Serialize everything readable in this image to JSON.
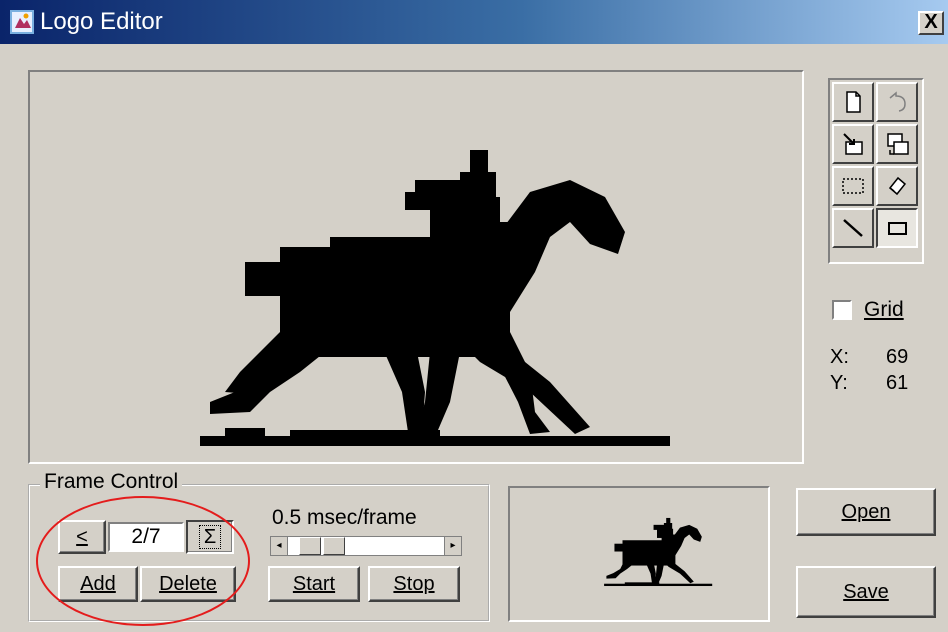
{
  "window": {
    "title": "Logo Editor",
    "close_label": "X"
  },
  "icons": {
    "app": "logo-editor-icon",
    "close": "close-icon",
    "tools": [
      "new-file-icon",
      "undo-icon",
      "import-icon",
      "export-icon",
      "select-rectangle-icon",
      "eraser-icon",
      "line-icon",
      "rectangle-icon"
    ]
  },
  "tools": {
    "pressed": "rectangle-icon"
  },
  "grid": {
    "label": "Grid",
    "checked": false
  },
  "coords": {
    "x_label": "X:",
    "x_value": "69",
    "y_label": "Y:",
    "y_value": "61"
  },
  "frame_control": {
    "label": "Frame Control",
    "prev_label": "<",
    "frame_value": "2/7",
    "loop_label": "Σ",
    "add_label": "Add",
    "delete_label": "Delete",
    "speed_label": "0.5 msec/frame",
    "speed_level": 0.25,
    "start_label": "Start",
    "stop_label": "Stop"
  },
  "buttons": {
    "open_label": "Open",
    "save_label": "Save"
  },
  "colors": {
    "title_start": "#0a246a",
    "title_end": "#a6caf0",
    "face": "#d4d0c8",
    "annotation": "#e41c1c"
  }
}
